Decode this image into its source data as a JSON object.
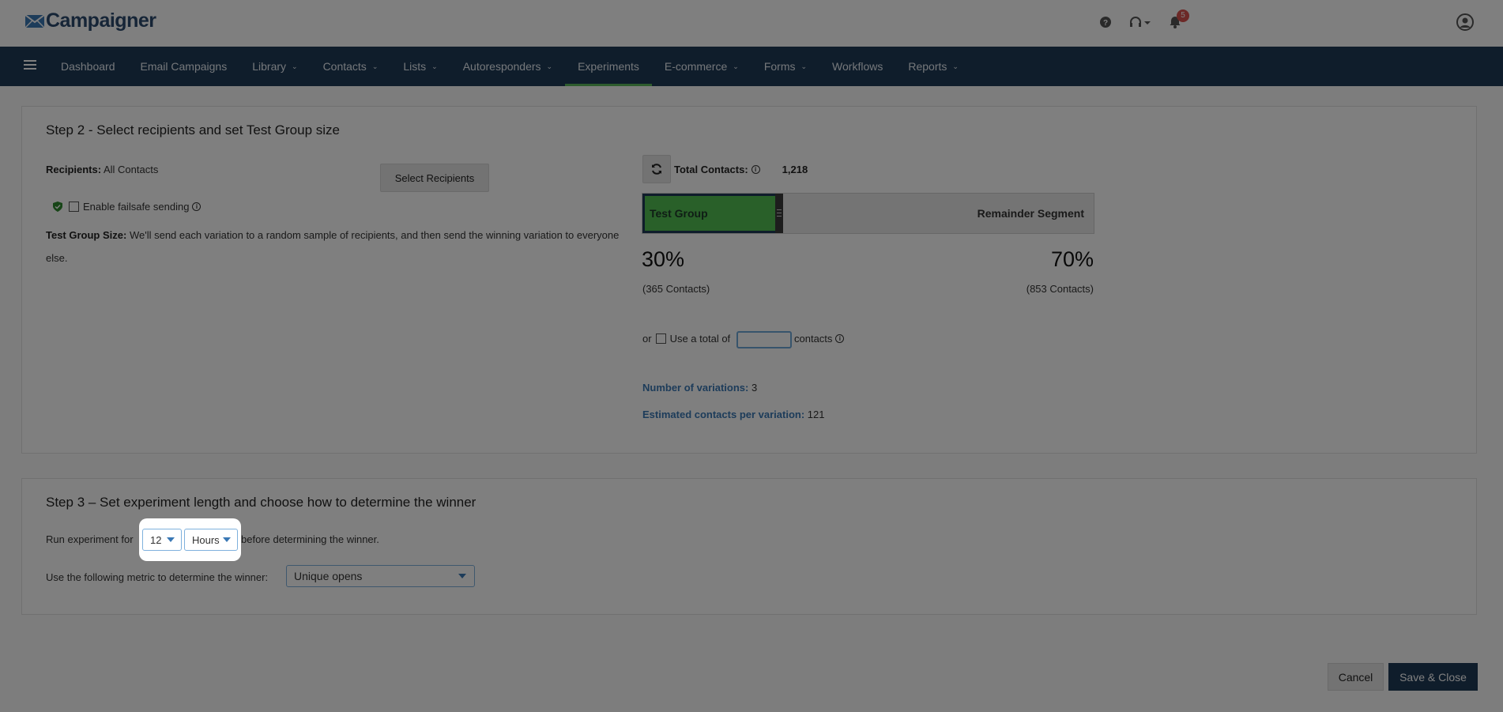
{
  "app": {
    "logo_text": "Campaigner"
  },
  "header": {
    "help_icon": "question-circle-icon",
    "support_icon": "headset-icon",
    "notifications_count": "5",
    "profile_icon": "user-circle-icon"
  },
  "nav": {
    "items": [
      {
        "label": "Dashboard",
        "dropdown": false
      },
      {
        "label": "Email Campaigns",
        "dropdown": false
      },
      {
        "label": "Library",
        "dropdown": true
      },
      {
        "label": "Contacts",
        "dropdown": true
      },
      {
        "label": "Lists",
        "dropdown": true
      },
      {
        "label": "Autoresponders",
        "dropdown": true
      },
      {
        "label": "Experiments",
        "dropdown": false,
        "active": true
      },
      {
        "label": "E-commerce",
        "dropdown": true
      },
      {
        "label": "Forms",
        "dropdown": true
      },
      {
        "label": "Workflows",
        "dropdown": false
      },
      {
        "label": "Reports",
        "dropdown": true
      }
    ]
  },
  "step2": {
    "title": "Step 2 - Select recipients and set Test Group size",
    "recipients_label": "Recipients:",
    "recipients_value": "All Contacts",
    "select_recipients_button": "Select Recipients",
    "failsafe_label": "Enable failsafe sending",
    "test_group_size_label": "Test Group Size:",
    "test_group_size_text": "We'll send each variation to a random sample of recipients, and then send the winning variation to everyone else.",
    "total_contacts_label": "Total Contacts:",
    "total_contacts_value": "1,218",
    "test_group_label": "Test Group",
    "remainder_label": "Remainder Segment",
    "test_percent": "30%",
    "test_contacts": "(365 Contacts)",
    "remainder_percent": "70%",
    "remainder_contacts": "(853 Contacts)",
    "or_label": "or",
    "use_total_label": "Use a total of",
    "use_total_value": "",
    "contacts_suffix": "contacts",
    "variations_label": "Number of variations:",
    "variations_value": "3",
    "per_variation_label": "Estimated contacts per variation:",
    "per_variation_value": "121"
  },
  "step3": {
    "title": "Step 3 – Set experiment length and choose how to determine the winner",
    "run_prefix": "Run experiment for",
    "length_value": "12",
    "length_unit": "Hours",
    "run_suffix": "before determining the winner.",
    "metric_label": "Use the following metric to determine the winner:",
    "metric_value": "Unique opens"
  },
  "footer": {
    "cancel_label": "Cancel",
    "save_label": "Save & Close"
  },
  "colors": {
    "nav_bg": "#1f3a56",
    "test_group": "#52c152",
    "accent_blue": "#3a78b5",
    "badge_red": "#d9534f"
  }
}
